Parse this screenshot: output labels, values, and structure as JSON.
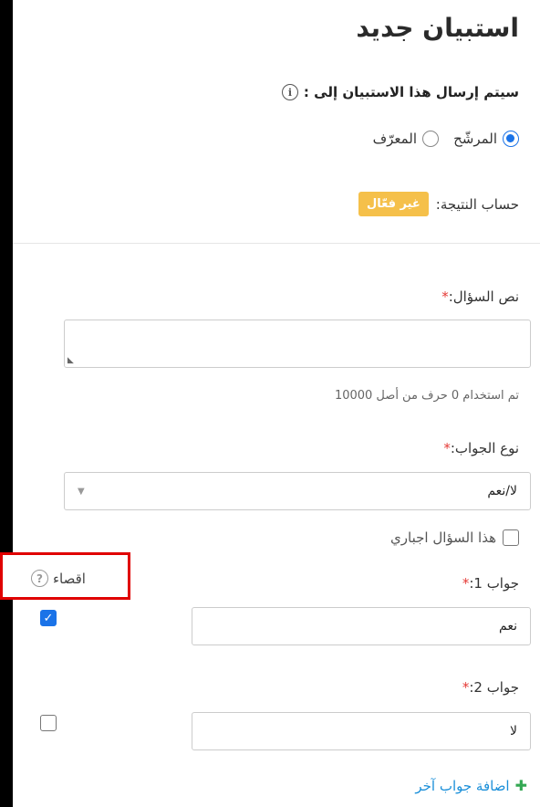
{
  "title": "استبيان جديد",
  "send_to": {
    "label": "سيتم إرسال هذا الاستبيان إلى :",
    "options": [
      {
        "label": "المرشّح",
        "selected": true
      },
      {
        "label": "المعرّف",
        "selected": false
      }
    ]
  },
  "score": {
    "label": "حساب النتيجة:",
    "status": "غير فعّال",
    "status_color": "#f5c04a"
  },
  "question": {
    "label": "نص السؤال:",
    "required_mark": "*",
    "value": "",
    "counter": "تم استخدام 0 حرف من أصل 10000"
  },
  "answer_type": {
    "label": "نوع الجواب:",
    "required_mark": "*",
    "selected": "لا/نعم"
  },
  "mandatory": {
    "label": "هذا السؤال اجباري",
    "checked": false
  },
  "exclude": {
    "label": "اقصاء",
    "highlight_color": "#e00000"
  },
  "answers": [
    {
      "label": "جواب 1:",
      "required_mark": "*",
      "value": "نعم",
      "exclude_checked": true
    },
    {
      "label": "جواب 2:",
      "required_mark": "*",
      "value": "لا",
      "exclude_checked": false
    }
  ],
  "add_answer": "اضافة جواب آخر",
  "accent_color": "#1a73e8"
}
